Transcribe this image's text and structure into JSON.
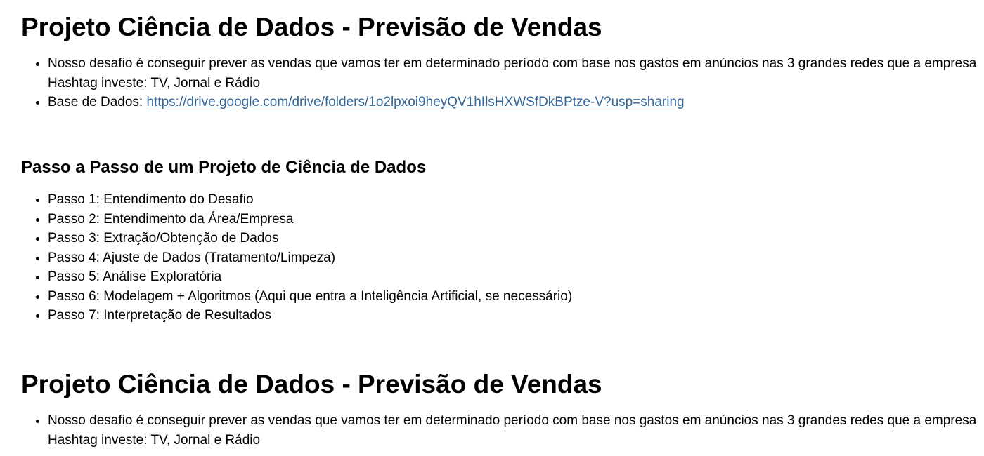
{
  "section1": {
    "title": "Projeto Ciência de Dados - Previsão de Vendas",
    "challenge": "Nosso desafio é conseguir prever as vendas que vamos ter em determinado período com base nos gastos em anúncios nas 3 grandes redes que a empresa Hashtag investe: TV, Jornal e Rádio",
    "database_label": "Base de Dados: ",
    "database_link": "https://drive.google.com/drive/folders/1o2lpxoi9heyQV1hIlsHXWSfDkBPtze-V?usp=sharing"
  },
  "section2": {
    "title": "Passo a Passo de um Projeto de Ciência de Dados",
    "steps": [
      "Passo 1: Entendimento do Desafio",
      "Passo 2: Entendimento da Área/Empresa",
      "Passo 3: Extração/Obtenção de Dados",
      "Passo 4: Ajuste de Dados (Tratamento/Limpeza)",
      "Passo 5: Análise Exploratória",
      "Passo 6: Modelagem + Algoritmos (Aqui que entra a Inteligência Artificial, se necessário)",
      "Passo 7: Interpretação de Resultados"
    ]
  },
  "section3": {
    "title": "Projeto Ciência de Dados - Previsão de Vendas",
    "challenge": "Nosso desafio é conseguir prever as vendas que vamos ter em determinado período com base nos gastos em anúncios nas 3 grandes redes que a empresa Hashtag investe: TV, Jornal e Rádio"
  },
  "colors": {
    "link": "#336699",
    "text": "#000000",
    "background": "#ffffff"
  }
}
